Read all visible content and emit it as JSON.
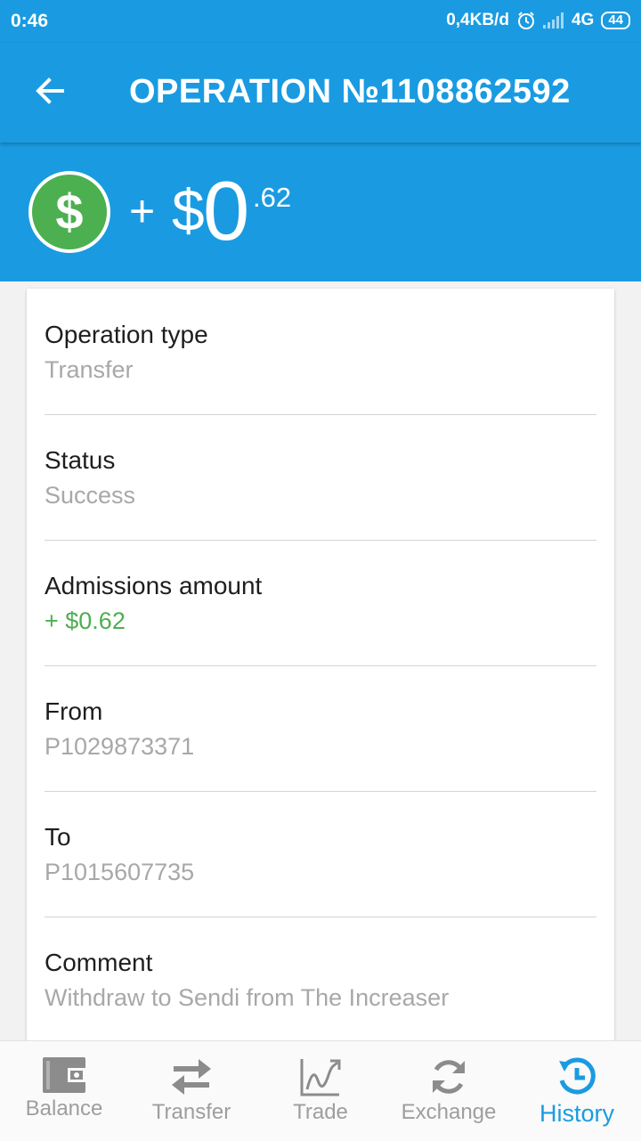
{
  "status_bar": {
    "time": "0:46",
    "network_speed": "0,4KB/d",
    "network_type": "4G",
    "battery": "44"
  },
  "header": {
    "title": "OPERATION №1108862592",
    "back_icon": "arrow-left-icon"
  },
  "amount": {
    "icon": "dollar-coin-icon",
    "sign": "+",
    "currency": "$",
    "integer": "0",
    "decimal": ".62"
  },
  "details": [
    {
      "label": "Operation type",
      "value": "Transfer"
    },
    {
      "label": "Status",
      "value": "Success"
    },
    {
      "label": "Admissions amount",
      "value": "+ $0.62"
    },
    {
      "label": "From",
      "value": "P1029873371"
    },
    {
      "label": "To",
      "value": "P1015607735"
    },
    {
      "label": "Comment",
      "value": "Withdraw to Sendi from The Increaser"
    }
  ],
  "bottom_nav": [
    {
      "label": "Balance",
      "icon": "wallet-icon",
      "active": false
    },
    {
      "label": "Transfer",
      "icon": "swap-arrows-icon",
      "active": false
    },
    {
      "label": "Trade",
      "icon": "chart-trend-icon",
      "active": false
    },
    {
      "label": "Exchange",
      "icon": "refresh-cycle-icon",
      "active": false
    },
    {
      "label": "History",
      "icon": "history-clock-icon",
      "active": true
    }
  ],
  "colors": {
    "primary": "#1a9be1",
    "positive": "#4caf50",
    "coin": "#4caf50",
    "muted_text": "#a8a8a8",
    "nav_icon": "#8c8c8c"
  }
}
